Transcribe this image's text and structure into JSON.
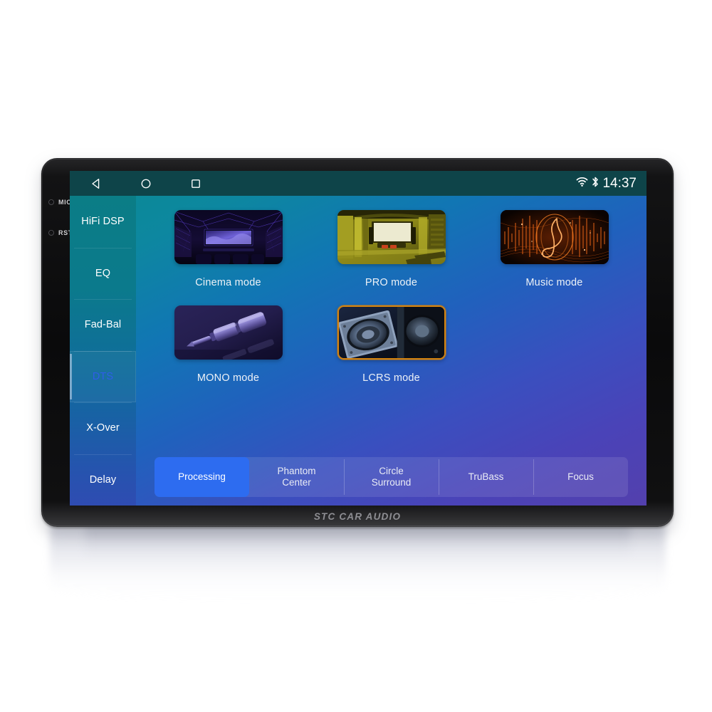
{
  "device": {
    "brand_label": "STC CAR AUDIO",
    "bezel_markers": [
      {
        "label": "MIC",
        "icon": "mic-hole-icon"
      },
      {
        "label": "RST",
        "icon": "reset-hole-icon"
      }
    ]
  },
  "statusbar": {
    "nav": [
      {
        "name": "back",
        "icon": "back-triangle-icon"
      },
      {
        "name": "home",
        "icon": "home-circle-icon"
      },
      {
        "name": "recents",
        "icon": "recents-square-icon"
      }
    ],
    "wifi_icon": "wifi-icon",
    "bluetooth_icon": "bluetooth-icon",
    "time": "14:37"
  },
  "sidebar": {
    "items": [
      {
        "label": "HiFi DSP",
        "active": false
      },
      {
        "label": "EQ",
        "active": false
      },
      {
        "label": "Fad-Bal",
        "active": false
      },
      {
        "label": "DTS",
        "active": true
      },
      {
        "label": "X-Over",
        "active": false
      },
      {
        "label": "Delay",
        "active": false
      }
    ],
    "active_text_color": "#2f5ee8"
  },
  "main": {
    "modes": [
      {
        "label": "Cinema mode",
        "thumb": "cinema-theater-thumb",
        "selected": false
      },
      {
        "label": "PRO mode",
        "thumb": "pro-studio-thumb",
        "selected": false
      },
      {
        "label": "Music mode",
        "thumb": "music-waveform-thumb",
        "selected": false
      },
      {
        "label": "MONO mode",
        "thumb": "audio-jack-thumb",
        "selected": false
      },
      {
        "label": "LCRS mode",
        "thumb": "speakers-thumb",
        "selected": true
      }
    ],
    "selection_border_color": "#d4830f",
    "tabs": [
      {
        "line1": "Processing",
        "line2": "",
        "active": true
      },
      {
        "line1": "Phantom",
        "line2": "Center",
        "active": false
      },
      {
        "line1": "Circle",
        "line2": "Surround",
        "active": false
      },
      {
        "line1": "TruBass",
        "line2": "",
        "active": false
      },
      {
        "line1": "Focus",
        "line2": "",
        "active": false
      }
    ],
    "active_tab_color": "#2d6cf0"
  }
}
